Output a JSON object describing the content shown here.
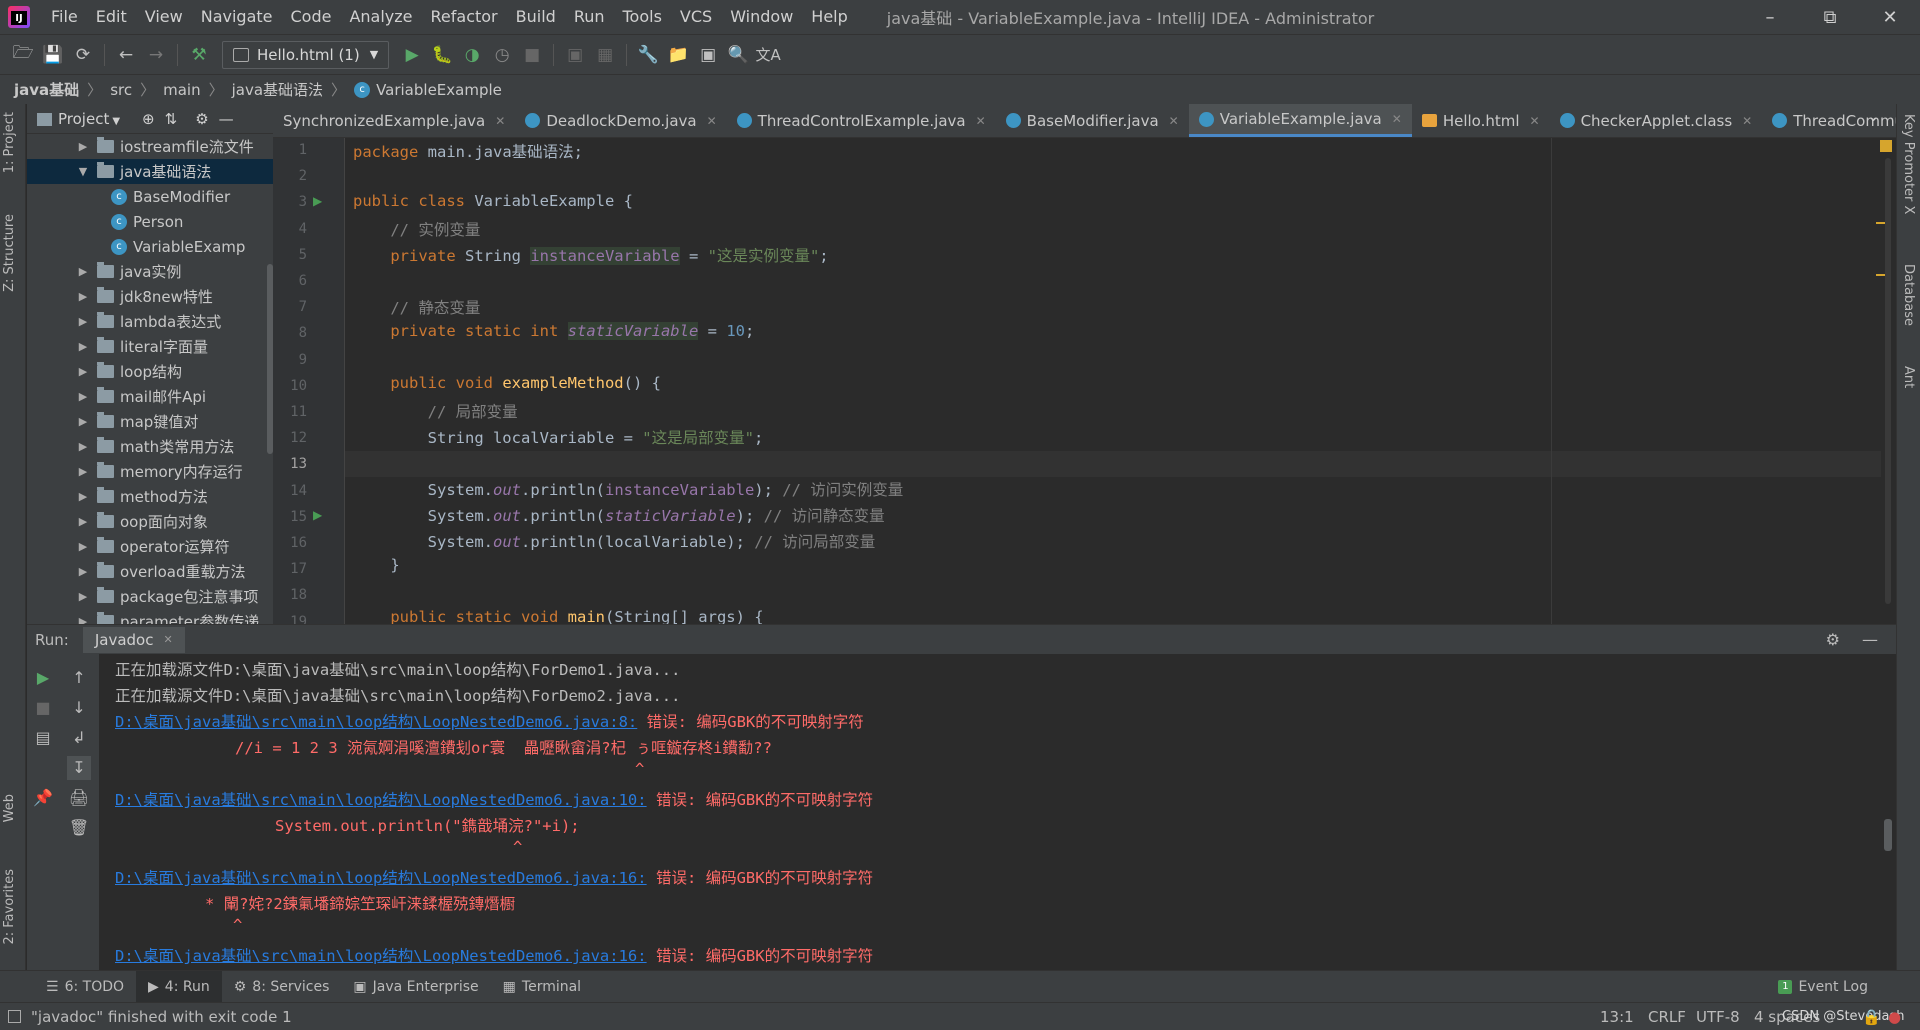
{
  "menu": {
    "items": [
      "File",
      "Edit",
      "View",
      "Navigate",
      "Code",
      "Analyze",
      "Refactor",
      "Build",
      "Run",
      "Tools",
      "VCS",
      "Window",
      "Help"
    ],
    "title": "java基础 - VariableExample.java - IntelliJ IDEA - Administrator"
  },
  "toolbar": {
    "run_config": "Hello.html (1)"
  },
  "breadcrumb": [
    "java基础",
    "src",
    "main",
    "java基础语法",
    "VariableExample"
  ],
  "left_stripe": {
    "project": "1: Project",
    "structure": "Z: Structure",
    "web": "Web",
    "favorites": "2: Favorites"
  },
  "right_stripe": {
    "key_promoter": "Key Promoter X",
    "database": "Database",
    "ant": "Ant"
  },
  "project": {
    "label": "Project",
    "tree": [
      {
        "label": "iostreamfile流文件",
        "kind": "folder",
        "expanded": false,
        "indent": 1
      },
      {
        "label": "java基础语法",
        "kind": "folder",
        "expanded": true,
        "indent": 1,
        "selected": true
      },
      {
        "label": "BaseModifier",
        "kind": "class",
        "indent": 2
      },
      {
        "label": "Person",
        "kind": "class",
        "indent": 2
      },
      {
        "label": "VariableExamp",
        "kind": "class",
        "indent": 2
      },
      {
        "label": "java实例",
        "kind": "folder",
        "expanded": false,
        "indent": 1
      },
      {
        "label": "jdk8new特性",
        "kind": "folder",
        "expanded": false,
        "indent": 1
      },
      {
        "label": "lambda表达式",
        "kind": "folder",
        "expanded": false,
        "indent": 1
      },
      {
        "label": "literal字面量",
        "kind": "folder",
        "expanded": false,
        "indent": 1
      },
      {
        "label": "loop结构",
        "kind": "folder",
        "expanded": false,
        "indent": 1
      },
      {
        "label": "mail邮件Api",
        "kind": "folder",
        "expanded": false,
        "indent": 1
      },
      {
        "label": "map键值对",
        "kind": "folder",
        "expanded": false,
        "indent": 1
      },
      {
        "label": "math类常用方法",
        "kind": "folder",
        "expanded": false,
        "indent": 1
      },
      {
        "label": "memory内存运行",
        "kind": "folder",
        "expanded": false,
        "indent": 1
      },
      {
        "label": "method方法",
        "kind": "folder",
        "expanded": false,
        "indent": 1
      },
      {
        "label": "oop面向对象",
        "kind": "folder",
        "expanded": false,
        "indent": 1
      },
      {
        "label": "operator运算符",
        "kind": "folder",
        "expanded": false,
        "indent": 1
      },
      {
        "label": "overload重载方法",
        "kind": "folder",
        "expanded": false,
        "indent": 1
      },
      {
        "label": "package包注意事项",
        "kind": "folder",
        "expanded": false,
        "indent": 1
      },
      {
        "label": "parameter参数传递",
        "kind": "folder",
        "expanded": false,
        "indent": 1
      }
    ]
  },
  "tabs": [
    {
      "label": "SynchronizedExample.java",
      "kind": "class",
      "active": false
    },
    {
      "label": "DeadlockDemo.java",
      "kind": "class",
      "active": false
    },
    {
      "label": "ThreadControlExample.java",
      "kind": "class",
      "active": false
    },
    {
      "label": "BaseModifier.java",
      "kind": "class",
      "active": false
    },
    {
      "label": "VariableExample.java",
      "kind": "class",
      "active": true
    },
    {
      "label": "Hello.html",
      "kind": "html",
      "active": false
    },
    {
      "label": "CheckerApplet.class",
      "kind": "class",
      "active": false
    },
    {
      "label": "ThreadCommu",
      "kind": "class",
      "active": false
    }
  ],
  "editor": {
    "line_numbers": [
      "1",
      "2",
      "3",
      "4",
      "5",
      "6",
      "7",
      "8",
      "9",
      "10",
      "11",
      "12",
      "13",
      "14",
      "15",
      "16",
      "17",
      "18",
      "19"
    ]
  },
  "run": {
    "label": "Run:",
    "tab": "Javadoc"
  },
  "console_lines": [
    "正在加载源文件D:\\桌面\\java基础\\src\\main\\loop结构\\ForDemo1.java...",
    "正在加载源文件D:\\桌面\\java基础\\src\\main\\loop结构\\ForDemo2.java..."
  ],
  "console_errors": [
    {
      "link": "D:\\桌面\\java基础\\src\\main\\loop结构\\LoopNestedDemo6.java:8:",
      "msg": " 错误: 编码GBK的不可映射字符",
      "detail": "//i = 1 2 3 涴氝婀涓嗘澶鐨刬or寰  畾嚦瞅畲涓?杞 ぅ哐鏇存柊i鐨勫??",
      "caret": "^"
    },
    {
      "link": "D:\\桌面\\java基础\\src\\main\\loop结构\\LoopNestedDemo6.java:10:",
      "msg": " 错误: 编码GBK的不可映射字符",
      "detail": "System.out.println(\"鐫戠埇浣?\"+i);",
      "caret": "^"
    },
    {
      "link": "D:\\桌面\\java基础\\src\\main\\loop结构\\LoopNestedDemo6.java:16:",
      "msg": " 错误: 编码GBK的不可映射字符",
      "detail": "* 閳?姹?2鍊氭墦鍗婃笁琛屽涞鍒楃殑鏄熸櫉",
      "caret": "^"
    },
    {
      "link": "D:\\桌面\\java基础\\src\\main\\loop结构\\LoopNestedDemo6.java:16:",
      "msg": " 错误: 编码GBK的不可映射字符"
    }
  ],
  "bottom_tabs": [
    "6: TODO",
    "4: Run",
    "8: Services",
    "Java Enterprise",
    "Terminal"
  ],
  "event_log": "Event Log",
  "status": {
    "message": "\"javadoc\" finished with exit code 1",
    "position": "13:1",
    "line_sep": "CRLF",
    "encoding": "UTF-8",
    "indent": "4 spaces",
    "watermark": "CSDN @Stevedash"
  },
  "colors": {
    "accent": "#4a88c7",
    "error": "#ff6b68",
    "link": "#287bde"
  }
}
